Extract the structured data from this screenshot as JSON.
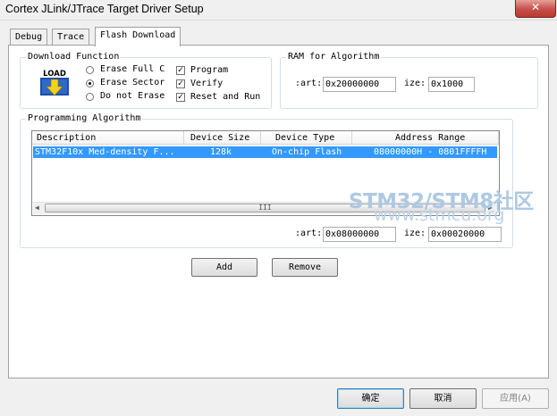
{
  "window": {
    "title": "Cortex JLink/JTrace Target Driver Setup",
    "close_glyph": "✕"
  },
  "tabs": [
    {
      "label": "Debug"
    },
    {
      "label": "Trace"
    },
    {
      "label": "Flash Download"
    }
  ],
  "download_function": {
    "legend": "Download Function",
    "icon_text": "LOAD",
    "radios": [
      {
        "label": "Erase Full C",
        "checked": false
      },
      {
        "label": "Erase Sector",
        "checked": true
      },
      {
        "label": "Do not Erase",
        "checked": false
      }
    ],
    "checkboxes": [
      {
        "label": "Program",
        "checked": true
      },
      {
        "label": "Verify",
        "checked": true
      },
      {
        "label": "Reset and Run",
        "checked": true
      }
    ]
  },
  "ram": {
    "legend": "RAM for Algorithm",
    "start_label": ":art:",
    "start_value": "0x20000000",
    "size_label": "ize:",
    "size_value": "0x1000"
  },
  "programming": {
    "legend": "Programming Algorithm",
    "columns": [
      "Description",
      "Device Size",
      "Device Type",
      "Address Range"
    ],
    "rows": [
      {
        "description": "STM32F10x Med-density F...",
        "size": "128k",
        "type": "On-chip Flash",
        "range": "08000000H - 0801FFFFH"
      }
    ],
    "scroll_grip": "III",
    "start_label": ":art:",
    "start_value": "0x08000000",
    "size_label": "ize:",
    "size_value": "0x00020000"
  },
  "buttons": {
    "add": "Add",
    "remove": "Remove",
    "ok": "确定",
    "cancel": "取消",
    "apply": "应用(A)"
  },
  "watermark": {
    "line1": "STM32/STM8社区",
    "line2": "www.stmcu.org"
  },
  "colors": {
    "selection": "#3399ff",
    "close_button": "#c75050"
  }
}
